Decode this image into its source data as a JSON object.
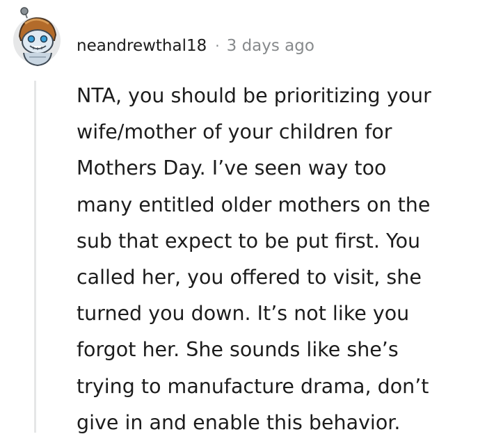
{
  "comment": {
    "username": "neandrewthal18",
    "separator": "·",
    "timestamp": "3 days ago",
    "avatar_icon": "snoo-avatar-icon",
    "body_lines": [
      "NTA, you should be prioritizing your",
      "wife/mother of your children for",
      "Mothers Day. I’ve seen way too",
      "many entitled older mothers on the",
      "sub that expect to be put first. You",
      "called her, you offered to visit, she",
      "turned you down. It’s not like you",
      "forgot her. She sounds like she’s",
      "trying to manufacture drama, don’t",
      "give in and enable this behavior."
    ]
  },
  "colors": {
    "text": "#1c1c1c",
    "meta_muted": "#878a8c",
    "thread_line": "#e5e6e7",
    "avatar_bg": "#e6e7e8",
    "avatar_helmet": "#b36b2a"
  }
}
